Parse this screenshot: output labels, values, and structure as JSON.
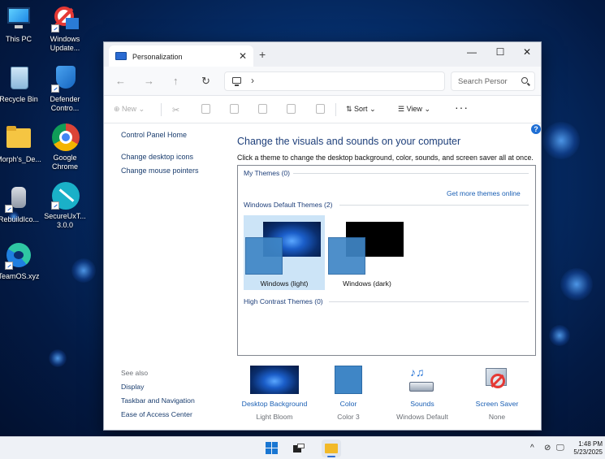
{
  "desktop": {
    "icons": [
      {
        "label": "This PC"
      },
      {
        "label": "Windows Update..."
      },
      {
        "label": "Recycle Bin"
      },
      {
        "label": "Defender Contro..."
      },
      {
        "label": "Morph's_De..."
      },
      {
        "label": "Google Chrome"
      },
      {
        "label": "RebuildIco..."
      },
      {
        "label": "SecureUxT... 3.0.0"
      },
      {
        "label": "TeamOS.xyz"
      }
    ]
  },
  "window": {
    "tab_title": "Personalization",
    "tab_close": "✕",
    "new_tab": "+",
    "controls": {
      "minimize": "—",
      "maximize": "☐",
      "close": "✕"
    },
    "nav": {
      "back": "←",
      "forward": "→",
      "up": "↑",
      "refresh": "↻",
      "chevron": "›"
    },
    "search_placeholder": "Search Persor",
    "toolbar": {
      "new": "New",
      "sort": "Sort",
      "view": "View",
      "more": "···"
    }
  },
  "left_pane": {
    "control_panel_home": "Control Panel Home",
    "links": [
      "Change desktop icons",
      "Change mouse pointers"
    ]
  },
  "main": {
    "heading": "Change the visuals and sounds on your computer",
    "subheading": "Click a theme to change the desktop background, color, sounds, and screen saver all at once.",
    "my_themes": "My Themes (0)",
    "get_more": "Get more themes online",
    "windows_default": "Windows Default Themes (2)",
    "themes": [
      {
        "name": "Windows (light)",
        "selected": true
      },
      {
        "name": "Windows (dark)",
        "selected": false
      }
    ],
    "high_contrast": "High Contrast Themes (0)"
  },
  "see_also": {
    "title": "See also",
    "links": [
      "Display",
      "Taskbar and Navigation",
      "Ease of Access Center"
    ]
  },
  "bottom_items": [
    {
      "title": "Desktop Background",
      "value": "Light Bloom"
    },
    {
      "title": "Color",
      "value": "Color 3"
    },
    {
      "title": "Sounds",
      "value": "Windows Default"
    },
    {
      "title": "Screen Saver",
      "value": "None"
    }
  ],
  "taskbar": {
    "time": "1:48 PM",
    "date": "5/23/2025",
    "tray_chevron": "^"
  },
  "colors": {
    "accent": "#1a5fb4",
    "selected_tile": "#cce4f7",
    "heading": "#1e3f7a"
  }
}
